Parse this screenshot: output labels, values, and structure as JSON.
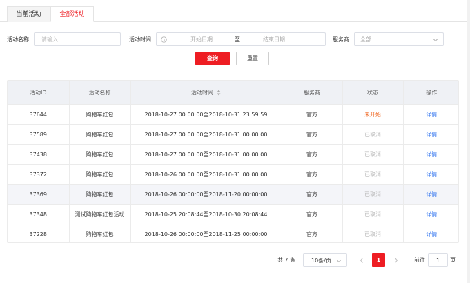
{
  "tabs": [
    {
      "label": "当前活动",
      "active": false
    },
    {
      "label": "全部活动",
      "active": true
    }
  ],
  "filters": {
    "name_label": "活动名称",
    "name_placeholder": "请输入",
    "time_label": "活动时间",
    "start_placeholder": "开始日期",
    "date_separator": "至",
    "end_placeholder": "结束日期",
    "provider_label": "服务商",
    "provider_value": "全部",
    "search_button": "查询",
    "reset_button": "重置"
  },
  "table": {
    "columns": [
      "活动ID",
      "活动名称",
      "活动时间",
      "服务商",
      "状态",
      "操作"
    ],
    "rows": [
      {
        "id": "37644",
        "name": "购物车红包",
        "time": "2018-10-27 00:00:00至2018-10-31 23:59:59",
        "provider": "官方",
        "status": "未开始",
        "action": "详情"
      },
      {
        "id": "37589",
        "name": "购物车红包",
        "time": "2018-10-27 00:00:00至2018-10-31 00:00:00",
        "provider": "官方",
        "status": "已取消",
        "action": "详情"
      },
      {
        "id": "37438",
        "name": "购物车红包",
        "time": "2018-10-27 00:00:00至2018-10-31 00:00:00",
        "provider": "官方",
        "status": "已取消",
        "action": "详情"
      },
      {
        "id": "37372",
        "name": "购物车红包",
        "time": "2018-10-26 00:00:00至2018-10-31 00:00:00",
        "provider": "官方",
        "status": "已取消",
        "action": "详情"
      },
      {
        "id": "37369",
        "name": "购物车红包",
        "time": "2018-10-26 00:00:00至2018-11-20 00:00:00",
        "provider": "官方",
        "status": "已取消",
        "action": "详情"
      },
      {
        "id": "37348",
        "name": "测试购物车红包活动",
        "time": "2018-10-25 20:08:44至2018-10-30 20:08:44",
        "provider": "官方",
        "status": "已取消",
        "action": "详情"
      },
      {
        "id": "37228",
        "name": "购物车红包",
        "time": "2018-10-26 00:00:00至2018-11-25 00:00:00",
        "provider": "官方",
        "status": "已取消",
        "action": "详情"
      }
    ]
  },
  "pagination": {
    "total_text": "共 7 条",
    "page_size": "10条/页",
    "current_page": "1",
    "goto_label": "前往",
    "goto_value": "1",
    "page_suffix": "页"
  },
  "colors": {
    "accent": "#ee1d23",
    "status_pending": "#f06a26",
    "status_cancelled": "#b8b8b8",
    "link": "#3d7cf0",
    "header_bg": "#eff1f5"
  },
  "icons": [
    "clock-icon",
    "chevron-down-icon",
    "sort-icon",
    "chevron-left-icon",
    "chevron-right-icon"
  ]
}
